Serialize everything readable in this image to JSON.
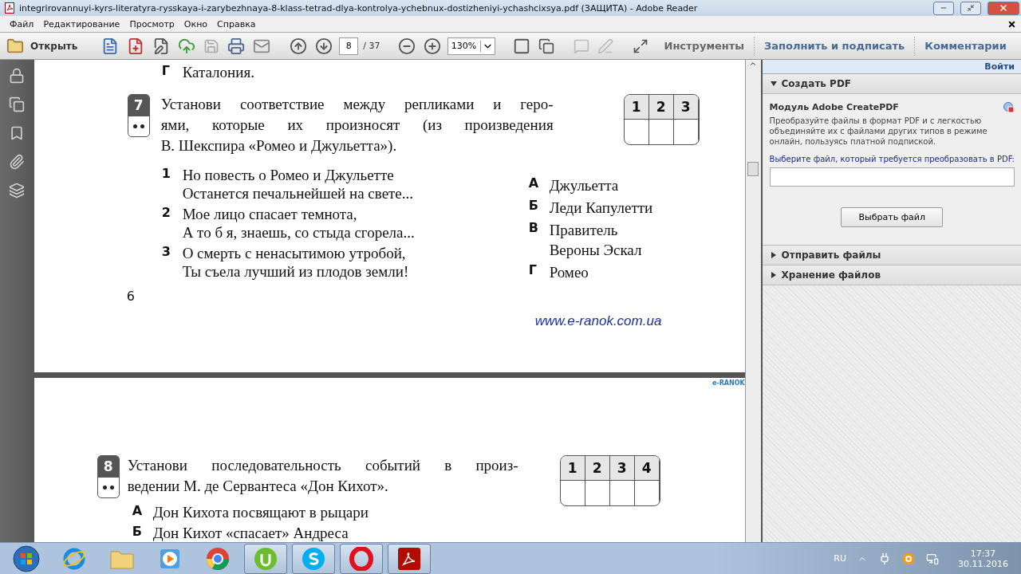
{
  "window": {
    "title": "integrirovannuyi-kyrs-literatyra-rysskaya-i-zarybezhnaya-8-klass-tetrad-dlya-kontrolya-ychebnux-dostizheniyi-ychashcixsya.pdf (ЗАЩИТА) - Adobe Reader"
  },
  "menu": [
    "Файл",
    "Редактирование",
    "Просмотр",
    "Окно",
    "Справка"
  ],
  "toolbar": {
    "open_label": "Открыть",
    "page_current": "8",
    "page_total": "/ 37",
    "zoom": "130%",
    "tabs": [
      {
        "label": "Инструменты",
        "selected": false
      },
      {
        "label": "Заполнить и подписать",
        "selected": false
      },
      {
        "label": "Комментарии",
        "selected": false
      }
    ]
  },
  "document": {
    "pages": [
      {
        "prev_answer": {
          "letter": "Г",
          "text": "Каталония."
        },
        "question": {
          "number": "7",
          "text_lines": [
            "Установи соответствие между репликами и геро-",
            "ями, которые их произносят (из произведения",
            "В. Шекспира «Ромео и Джульетта»)."
          ],
          "answer_headers": [
            "1",
            "2",
            "3"
          ],
          "quotes": [
            {
              "number": "1",
              "lines": [
                "Но повесть о Ромео и Джульетте",
                "Останется печальнейшей на свете..."
              ]
            },
            {
              "number": "2",
              "lines": [
                "Мое лицо спасает темнота,",
                "А то б я, знаешь, со стыда сгорела..."
              ]
            },
            {
              "number": "3",
              "lines": [
                "О смерть с ненасытимою утробой,",
                "Ты съела лучший из плодов земли!"
              ]
            }
          ],
          "options": [
            {
              "letter": "А",
              "lines": [
                "Джульетта"
              ]
            },
            {
              "letter": "Б",
              "lines": [
                "Леди Капулетти"
              ]
            },
            {
              "letter": "В",
              "lines": [
                "Правитель",
                "Вероны Эскал"
              ]
            },
            {
              "letter": "Г",
              "lines": [
                "Ромео"
              ]
            }
          ]
        },
        "page_number": "6",
        "link": "www.e-ranok.com.ua"
      },
      {
        "logo": "e-RANOK",
        "question": {
          "number": "8",
          "text_lines": [
            "Установи последовательность событий в произ-",
            "ведении М. де Сервантеса «Дон Кихот»."
          ],
          "answer_headers": [
            "1",
            "2",
            "3",
            "4"
          ],
          "events": [
            {
              "letter": "А",
              "text": "Дон Кихота посвящают в рыцари"
            },
            {
              "letter": "Б",
              "text": "Дон Кихот «спасает» Андреса"
            }
          ]
        }
      }
    ]
  },
  "right_pane": {
    "sign_in": "Войти",
    "sections": [
      {
        "title": "Создать PDF",
        "expanded": true
      },
      {
        "title": "Отправить файлы",
        "expanded": false
      },
      {
        "title": "Хранение файлов",
        "expanded": false
      }
    ],
    "create_pdf": {
      "title": "Модуль Adobe CreatePDF",
      "description": "Преобразуйте файлы в формат PDF и с легкостью объединяйте их с файлами других типов в режиме онлайн, пользуясь платной подпиской.",
      "prompt": "Выберите файл, который требуется преобразовать в PDF:",
      "button": "Выбрать файл"
    }
  },
  "taskbar": {
    "apps": [
      {
        "kind": "start",
        "running": false
      },
      {
        "kind": "browser-e",
        "running": false
      },
      {
        "kind": "folder",
        "running": false
      },
      {
        "kind": "player",
        "running": false
      },
      {
        "kind": "browser-c",
        "running": false
      },
      {
        "kind": "torrent",
        "running": true
      },
      {
        "kind": "chat",
        "running": true
      },
      {
        "kind": "browser-o",
        "running": true
      },
      {
        "kind": "pdf",
        "running": true
      }
    ],
    "language": "RU",
    "time": "17:37",
    "date": "30.11.2016"
  }
}
